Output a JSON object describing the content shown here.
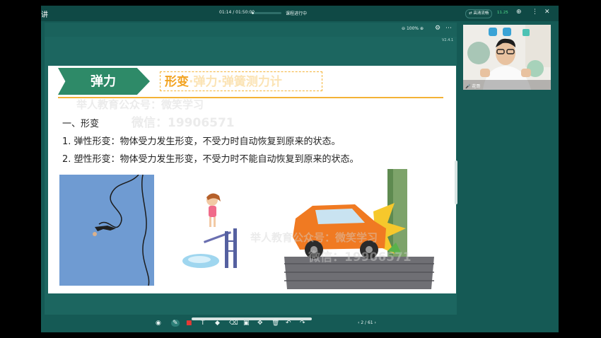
{
  "topbar": {
    "app_label": "讲",
    "time": "01:14 / 01:50:00",
    "progress": 0.011,
    "status": "课程进行中",
    "quality_label": "高清流畅",
    "network_badge": "11.25"
  },
  "slide_window": {
    "zoom": "100%",
    "version": "V2.4.1"
  },
  "slide": {
    "title": "弹力",
    "subtitle_current": "形变",
    "subtitle_rest": "·弹力·弹簧测力计",
    "section_heading": "一、形变",
    "line1": "1. 弹性形变：物体受力发生形变，不受力时自动恢复到原来的状态。",
    "line2": "2. 塑性形变：物体受力发生形变，不受力时不能自动恢复到原来的状态。",
    "watermarks": [
      "举人教育公众号：微笑学习",
      "微信：19906571",
      "举人教育公众号：微笑学习",
      "微信：19906571"
    ]
  },
  "video": {
    "name": "花哥"
  },
  "bottombar": {
    "page": "2 / 61"
  },
  "colors": {
    "app_bg": "#155a55",
    "title_green": "#2e8a68",
    "accent_orange": "#f4b336"
  }
}
